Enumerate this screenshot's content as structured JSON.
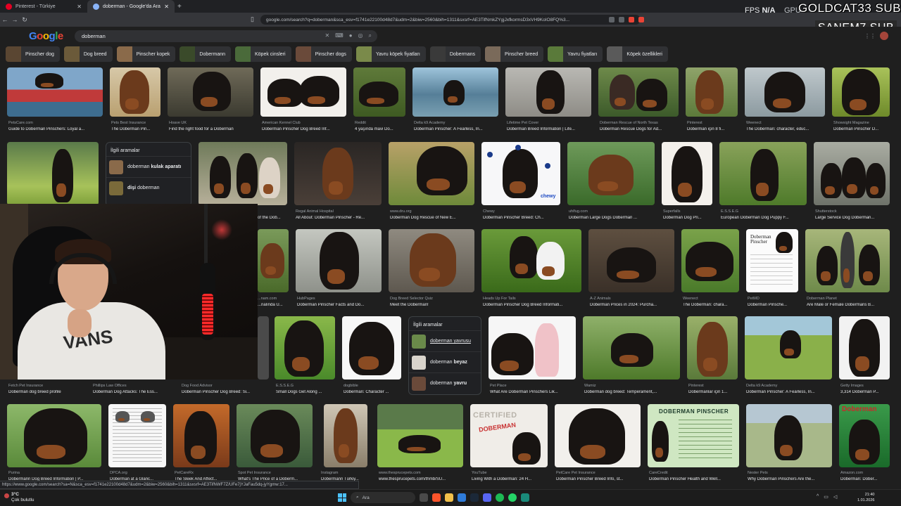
{
  "browser": {
    "tabs": [
      {
        "label": "Pinterest - Türkiye",
        "active": false
      },
      {
        "label": "doberman - Google'da Ara",
        "active": true
      }
    ],
    "url": "google.com/search?q=doberman&sca_esv=f1741e22100d48d7&udm=2&biw=2560&bih=1311&sxsrf=AE3TifNmkZYgjJxfkormsD3xVH9KoIO8FQ%3..."
  },
  "overlay": {
    "fps_label": "FPS",
    "fps_value": "N/A",
    "gpu_label": "GPU",
    "sub1": "GOLDCAT33 SUB",
    "sub2": "SANEM7 SUB"
  },
  "google": {
    "logo": {
      "g1": "G",
      "o1": "o",
      "o2": "o",
      "g2": "g",
      "l": "l",
      "e": "e"
    },
    "query": "doberman"
  },
  "chips": [
    "Pinscher dog",
    "Dog breed",
    "Pinscher kopek",
    "Dobermann",
    "Köpek cinsleri",
    "Pinscher dogs",
    "Yavru köpek fiyatları",
    "Dobermans",
    "Pinscher breed",
    "Yavru fiyatları",
    "Köpek özellikleri"
  ],
  "row1": [
    {
      "src": "PetsCare.com",
      "cap": "Guide to Doberman Pinschers: Loyal a..."
    },
    {
      "src": "Pets Best Insurance",
      "cap": "The Doberman Pin..."
    },
    {
      "src": "Hoave UK",
      "cap": "Find the right food for a Doberman"
    },
    {
      "src": "American Kennel Club",
      "cap": "Doberman Pinscher Dog Breed Inf..."
    },
    {
      "src": "Reddit",
      "cap": "4 yaşında mavi Do..."
    },
    {
      "src": "Delta k9 Academy",
      "cap": "Doberman Pinscher: A Fearless, In..."
    },
    {
      "src": "Lifetime Pet Cover",
      "cap": "Doberman Breed Information | Life..."
    },
    {
      "src": "Doberman Rescue of North Texas",
      "cap": "Doberman Rescue Dogs for Ad..."
    },
    {
      "src": "Pinterest",
      "cap": "Doberman için 8 fi..."
    },
    {
      "src": "Weenect",
      "cap": "The Doberman: character, educ..."
    },
    {
      "src": "Showsight Magazine",
      "cap": "Doberman Pinscher D..."
    }
  ],
  "related1": {
    "heading": "İlgili aramalar",
    "items": [
      {
        "pre": "doberman ",
        "bold": "kulak aparatı"
      },
      {
        "pre": "",
        "bold": "dişi",
        "post": " doberman"
      }
    ]
  },
  "row2": [
    {
      "src": "",
      "cap": "of the Dob..."
    },
    {
      "src": "Regal Animal Hospital",
      "cap": "All About: Doberman Pinscher - Re..."
    },
    {
      "src": "www.dru.org",
      "cap": "Doberman Dog Rescue of New E..."
    },
    {
      "src": "Chewy",
      "cap": "Doberman Pinscher Breed: Ch..."
    },
    {
      "src": "uhlfug.com",
      "cap": "Doberman Large Dogs Doberman ..."
    },
    {
      "src": "Superfalls",
      "cap": "Doberman Dog Pri..."
    },
    {
      "src": "E.S.S.E.G",
      "cap": "European Doberman Dog Puppy F..."
    },
    {
      "src": "Shutterstock",
      "cap": "Large Service Dog Doberman..."
    }
  ],
  "row3": [
    {
      "src": "...nam.com",
      "cap": "...nalında U..."
    },
    {
      "src": "HubPages",
      "cap": "Doberman Pinscher Facts and Do..."
    },
    {
      "src": "Dog Breed Selector Quiz",
      "cap": "Meet the Doberman!"
    },
    {
      "src": "Heads Up For Tails",
      "cap": "Doberman Pinscher Dog Breed Informati..."
    },
    {
      "src": "A-Z Animals",
      "cap": "Doberman Prices in 2024: Purcha..."
    },
    {
      "src": "Weenect",
      "cap": "The Doberman: chara..."
    },
    {
      "src": "PetMD",
      "cap": "Doberman Pinsche..."
    },
    {
      "src": "Doberman Planet",
      "cap": "Are Male or Female Dobermans B..."
    }
  ],
  "related2": {
    "heading": "İlgili aramalar",
    "items": [
      {
        "pre": "",
        "link": "doberman yavrusu"
      },
      {
        "pre": "doberman ",
        "bold": "beyaz"
      },
      {
        "pre": "doberman ",
        "bold": "yavru"
      }
    ]
  },
  "row4": [
    {
      "src": "Fetch Pet Insurance",
      "cap": "Doberman dog breed profile"
    },
    {
      "src": "Phillips Law Offices",
      "cap": "Doberman Dog Attacks: The Ess..."
    },
    {
      "src": "Dog Food Advisor",
      "cap": "Doberman Pinscher Dog Breed: Si..."
    },
    {
      "src": "E.S.S.E.G",
      "cap": "Small Dogs Get Along ..."
    },
    {
      "src": "dogbible",
      "cap": "Doberman: Character ..."
    },
    {
      "src": "Pet Place",
      "cap": "What Are Doberman Pinschers Lik..."
    },
    {
      "src": "Wamiz",
      "cap": "Doberman dog breed: Temperament,..."
    },
    {
      "src": "Pinterest",
      "cap": "Dobermanlar için 1..."
    },
    {
      "src": "Delta k9 Academy",
      "cap": "Doberman Pinscher: A Fearless, In..."
    },
    {
      "src": "Getty Images",
      "cap": "3,314 Doberman P..."
    }
  ],
  "row5": [
    {
      "src": "Purina",
      "cap": "Dobermann Dog Breed Information | P..."
    },
    {
      "src": "DPCA.org",
      "cap": "Doberman at a Glanc..."
    },
    {
      "src": "PetCareRx",
      "cap": "The Sleek And Affect..."
    },
    {
      "src": "Spot Pet Insurance",
      "cap": "What's The Price of a Doberm..."
    },
    {
      "src": "Instagram",
      "cap": "Dobermann Türkiy..."
    },
    {
      "src": "www.thesprucepets.com",
      "cap": "www.thesprucepets.com/thmb/SU..."
    },
    {
      "src": "YouTube",
      "cap": "Living With a Doberman: 24 H..."
    },
    {
      "src": "PetCare Pet Insurance",
      "cap": "Doberman Pinscher Breed Info, st..."
    },
    {
      "src": "CareCredit",
      "cap": "Doberman Pinscher Health and Well..."
    },
    {
      "src": "Nester Pets",
      "cap": "Why Doberman Pinschers Are the..."
    },
    {
      "src": "Amazon.com",
      "cap": "Doberman: Dober..."
    }
  ],
  "image_text": {
    "certified": "CERTIFIED",
    "doberman_stamp": "DOBERMAN",
    "poster_title": "DOBERMAN PINSCHER",
    "card_title": "Doberman Pinscher",
    "amazon_title": "Doberman"
  },
  "webcam": {
    "shirt_text": "VANS"
  },
  "statusbar": "https://www.google.com/search?sa=N&sca_esv=f1741e22100d48d7&udm=2&biw=2560&bih=1311&sxsrf=AE3TifNWF7Z/UFe7jYJaFau5dq-jyYgmw:17...",
  "taskbar": {
    "temp": "3°C",
    "weather": "Çok bulutlu",
    "search_placeholder": "Ara",
    "time": "21:40",
    "date": "1.01.2026"
  }
}
